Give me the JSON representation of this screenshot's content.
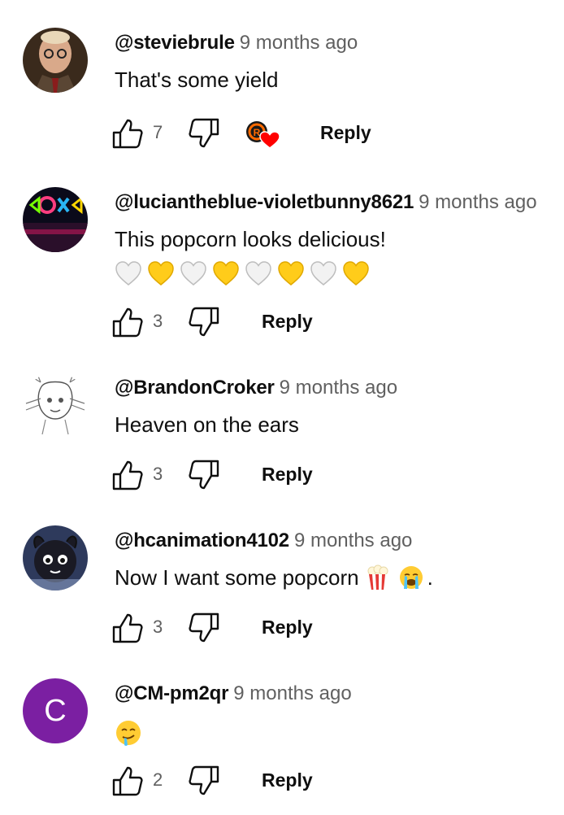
{
  "comments": [
    {
      "author": "@steviebrule",
      "time": "9 months ago",
      "text": "That's some yield",
      "likes": "7",
      "reply_label": "Reply",
      "creator_heart": true,
      "avatar_icon": "photo-avatar"
    },
    {
      "author": "@luciantheblue-violetbunny8621",
      "time": "9 months ago",
      "text": "This popcorn looks delicious!",
      "emoji_line": [
        "white-heart",
        "yellow-heart",
        "white-heart",
        "yellow-heart",
        "white-heart",
        "yellow-heart",
        "white-heart",
        "yellow-heart"
      ],
      "likes": "3",
      "reply_label": "Reply",
      "avatar_icon": "neon-sign-avatar"
    },
    {
      "author": "@BrandonCroker",
      "time": "9 months ago",
      "text": "Heaven on the ears",
      "likes": "3",
      "reply_label": "Reply",
      "avatar_icon": "sketch-avatar"
    },
    {
      "author": "@hcanimation4102",
      "time": "9 months ago",
      "text": "Now I want some popcorn",
      "trailing_emojis": [
        "popcorn-emoji",
        "crying-face-emoji"
      ],
      "trailing_text": ".",
      "likes": "3",
      "reply_label": "Reply",
      "avatar_icon": "cartoon-avatar"
    },
    {
      "author": "@CM-pm2qr",
      "time": "9 months ago",
      "text": "",
      "text_emoji": "drooling-face-emoji",
      "likes": "2",
      "reply_label": "Reply",
      "avatar_letter": "C",
      "avatar_color": "#7b1fa2"
    }
  ],
  "colors": {
    "text_primary": "#0f0f0f",
    "text_secondary": "#606060",
    "heart_red": "#ff0000"
  }
}
